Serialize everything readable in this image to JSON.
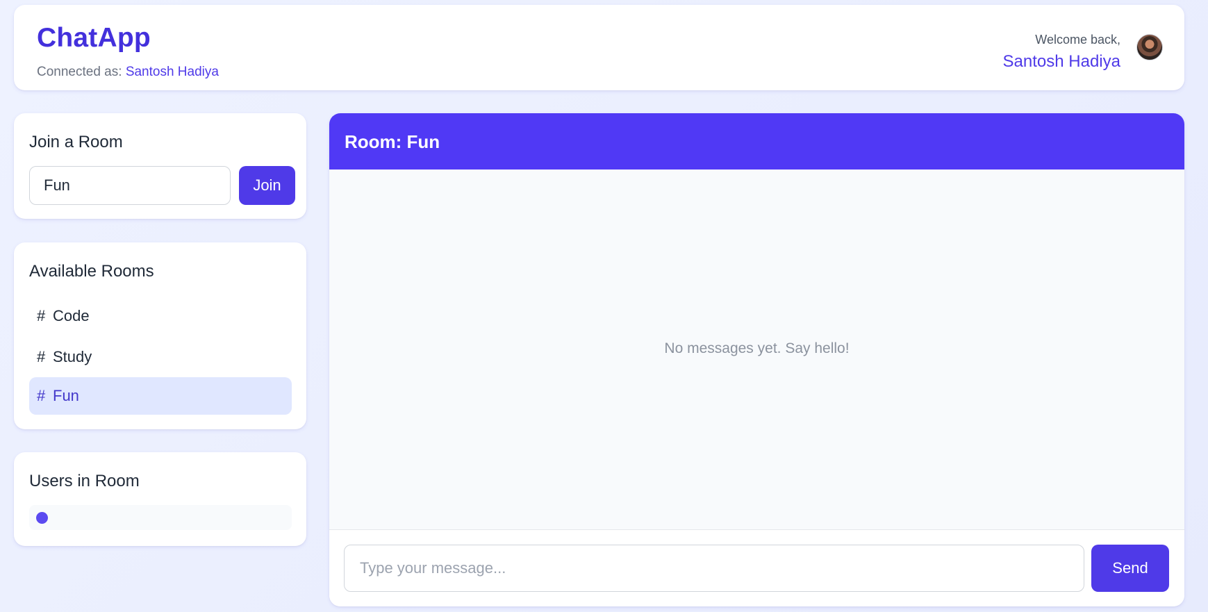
{
  "header": {
    "app_name": "ChatApp",
    "connected_prefix": "Connected as: ",
    "connected_user": "Santosh Hadiya",
    "welcome_text": "Welcome back,",
    "welcome_user": "Santosh Hadiya"
  },
  "join_room": {
    "title": "Join a Room",
    "input_value": "Fun",
    "button_label": "Join"
  },
  "available_rooms": {
    "title": "Available Rooms",
    "items": [
      {
        "hash": "#",
        "label": "Code",
        "active": false
      },
      {
        "hash": "#",
        "label": "Study",
        "active": false
      },
      {
        "hash": "#",
        "label": "Fun",
        "active": true
      }
    ]
  },
  "users_in_room": {
    "title": "Users in Room"
  },
  "chat": {
    "room_title": "Room: Fun",
    "empty_message": "No messages yet. Say hello!",
    "input_placeholder": "Type your message...",
    "send_label": "Send"
  },
  "colors": {
    "accent": "#4f3ae8",
    "chat_header": "#5039f5",
    "active_room_bg": "#e0e7ff",
    "user_dot": "#5b4af0"
  }
}
